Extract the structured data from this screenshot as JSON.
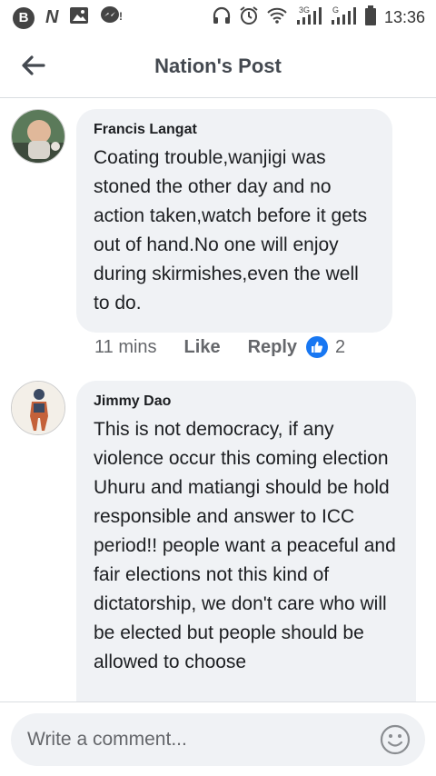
{
  "status_bar": {
    "time": "13:36",
    "left_icons": [
      "b-circle-icon",
      "n-notification-icon",
      "image-icon",
      "messenger-icon"
    ],
    "right_icons": [
      "headphones-icon",
      "alarm-icon",
      "wifi-icon",
      "signal-3g-icon",
      "signal-g-icon",
      "battery-icon"
    ],
    "net_3g": "3G",
    "net_g": "G"
  },
  "header": {
    "back_icon": "arrow-left-icon",
    "title": "Nation's Post"
  },
  "comments": [
    {
      "author": "Francis Langat",
      "text": "Coating trouble,wanjigi was stoned the other day and no action taken,watch before it gets out of hand.No one will enjoy during skirmishes,even the well to do.",
      "time": "11 mins",
      "like_label": "Like",
      "reply_label": "Reply",
      "reaction_count": "2",
      "reaction_icon": "thumbs-up-icon"
    },
    {
      "author": "Jimmy Dao",
      "text": "This is not democracy, if any violence occur this coming election Uhuru and matiangi should be hold responsible and answer to ICC period!! people want a peaceful and fair elections not this kind of dictatorship, we don't care who will be elected but people should be allowed to choose"
    }
  ],
  "composer": {
    "placeholder": "Write a comment...",
    "emoji_icon": "smiley-icon"
  },
  "colors": {
    "accent": "#1877f2",
    "bubble": "#f0f2f5",
    "secondary_text": "#65676b"
  }
}
